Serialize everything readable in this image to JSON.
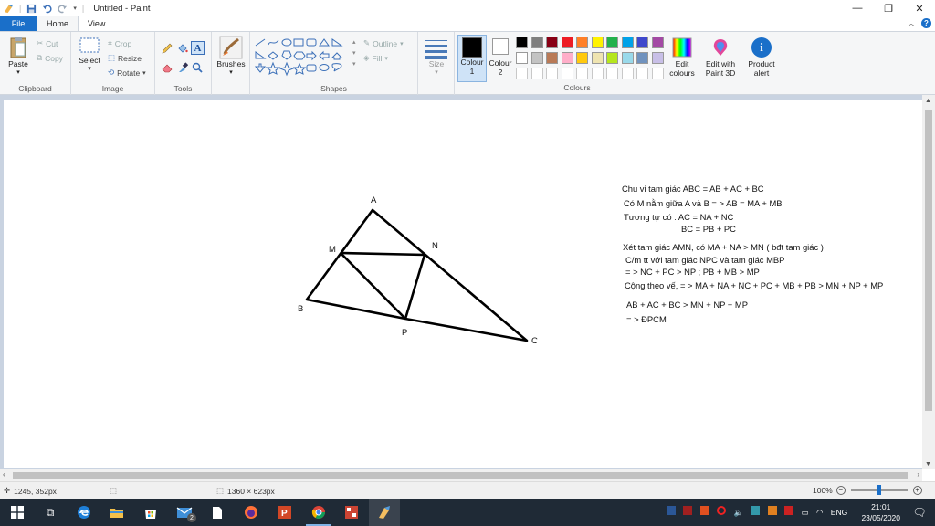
{
  "window": {
    "title": "Untitled - Paint"
  },
  "tabs": {
    "file": "File",
    "home": "Home",
    "view": "View"
  },
  "clipboard": {
    "paste": "Paste",
    "cut": "Cut",
    "copy": "Copy",
    "label": "Clipboard"
  },
  "image": {
    "select": "Select",
    "crop": "Crop",
    "resize": "Resize",
    "rotate": "Rotate",
    "label": "Image"
  },
  "tools": {
    "label": "Tools"
  },
  "brushes": {
    "label": "Brushes"
  },
  "shapes": {
    "outline": "Outline",
    "fill": "Fill",
    "label": "Shapes"
  },
  "size": {
    "label": "Size"
  },
  "colours": {
    "colour1": "Colour 1",
    "colour1_line2": "1",
    "colour2": "Colour",
    "colour2_line2": "2",
    "colour1_label": "Colour",
    "edit_colours": "Edit colours",
    "edit_l1": "Edit",
    "edit_l2": "colours",
    "paint3d_l1": "Edit with",
    "paint3d_l2": "Paint 3D",
    "alert_l1": "Product",
    "alert_l2": "alert",
    "label": "Colours",
    "palette_row1": [
      "#000000",
      "#7f7f7f",
      "#880015",
      "#ed1c24",
      "#ff7f27",
      "#fff200",
      "#22b14c",
      "#00a2e8",
      "#3f48cc",
      "#a349a4"
    ],
    "palette_row2": [
      "#ffffff",
      "#c3c3c3",
      "#b97a57",
      "#ffaec9",
      "#ffc90e",
      "#efe4b0",
      "#b5e61d",
      "#99d9ea",
      "#7092be",
      "#c8bfe7"
    ]
  },
  "drawing": {
    "labels": {
      "A": "A",
      "M": "M",
      "N": "N",
      "B": "B",
      "P": "P",
      "C": "C"
    },
    "proof": [
      "Chu vi tam giác ABC = AB + AC + BC",
      "Có M nằm giữa A và B = > AB = MA + MB",
      "Tương tự có : AC = NA + NC",
      "BC = PB + PC",
      "Xét tam giác AMN, có MA + NA > MN ( bđt tam giác )",
      "C/m tt với tam giác NPC và tam giác MBP",
      "= > NC + PC > NP ; PB + MB > MP",
      "Cộng theo vế, = > MA + NA + NC + PC + MB + PB > MN + NP + MP",
      "AB + AC + BC > MN + NP + MP",
      "= > ĐPCM"
    ]
  },
  "status": {
    "cursor": "1245, 352px",
    "canvas_size": "1360 × 623px",
    "zoom": "100%"
  },
  "taskbar": {
    "lang": "ENG",
    "time": "21:01",
    "date": "23/05/2020",
    "mail_badge": "2"
  }
}
